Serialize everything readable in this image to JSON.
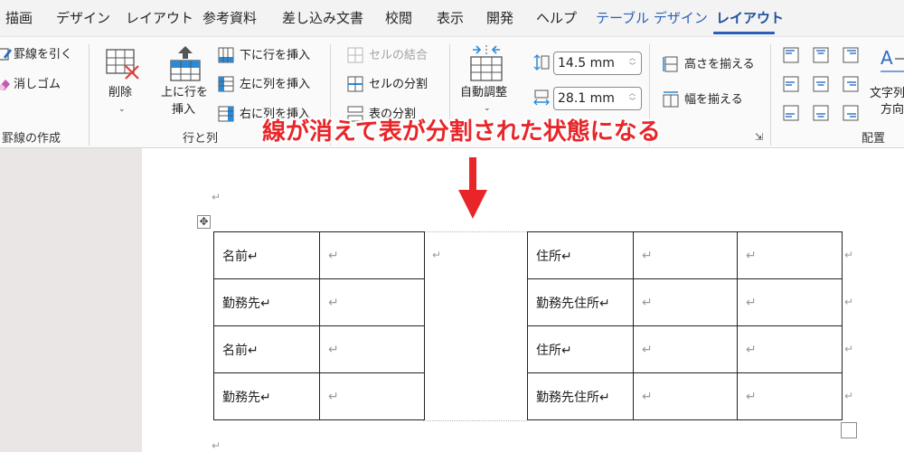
{
  "tabs": [
    {
      "label": "描画"
    },
    {
      "label": "デザイン"
    },
    {
      "label": "レイアウト"
    },
    {
      "label": "参考資料"
    },
    {
      "label": "差し込み文書"
    },
    {
      "label": "校閲"
    },
    {
      "label": "表示"
    },
    {
      "label": "開発"
    },
    {
      "label": "ヘルプ"
    },
    {
      "label": "テーブル デザイン"
    },
    {
      "label": "レイアウト"
    }
  ],
  "ribbon": {
    "draw": {
      "draw_borders": "罫線を引く",
      "eraser": "消しゴム",
      "group_label": "罫線の作成"
    },
    "delete_label": "削除",
    "insert_above_line1": "上に行を",
    "insert_above_line2": "挿入",
    "insert_below": "下に行を挿入",
    "insert_left": "左に列を挿入",
    "insert_right": "右に列を挿入",
    "rows_cols_label": "行と列",
    "merge_cells": "セルの結合",
    "split_cells": "セルの分割",
    "split_table": "表の分割",
    "autofit": "自動調整",
    "height_value": "14.5 mm",
    "width_value": "28.1 mm",
    "distribute_rows": "高さを揃える",
    "distribute_cols": "幅を揃える",
    "text_direction_line1": "文字列",
    "text_direction_line2": "方向",
    "align_label": "配置"
  },
  "annotation": "線が消えて表が分割された状態になる",
  "para_mark": "↵",
  "table_left": [
    [
      "名前↵",
      "↵"
    ],
    [
      "勤務先↵",
      "↵"
    ],
    [
      "名前↵",
      "↵"
    ],
    [
      "勤務先↵",
      "↵"
    ]
  ],
  "table_right": [
    [
      "住所↵",
      "↵",
      "↵"
    ],
    [
      "勤務先住所↵",
      "↵",
      "↵"
    ],
    [
      "住所↵",
      "↵",
      "↵"
    ],
    [
      "勤務先住所↵",
      "↵",
      "↵"
    ]
  ],
  "colors": {
    "accent": "#2b5fb5",
    "annotation": "#e8262a"
  }
}
